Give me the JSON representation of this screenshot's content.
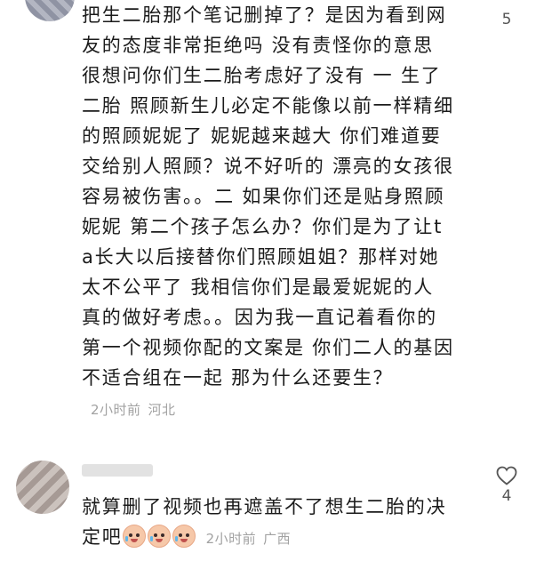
{
  "comments": [
    {
      "text": "把生二胎那个笔记删掉了？是因为看到网友的态度非常拒绝吗 没有责怪你的意思 很想问你们生二胎考虑好了没有 一 生了二胎 照顾新生儿必定不能像以前一样精细的照顾妮妮了 妮妮越来越大 你们难道要交给别人照顾？说不好听的 漂亮的女孩很容易被伤害。。二 如果你们还是贴身照顾妮妮 第二个孩子怎么办？你们是为了让ta长大以后接替你们照顾姐姐？那样对她太不公平了 我相信你们是最爱妮妮的人 真的做好考虑。。因为我一直记着看你的第一个视频你配的文案是 你们二人的基因不适合组在一起 那为什么还要生？",
      "time": "2小时前",
      "location": "河北",
      "likes": "5"
    },
    {
      "text": "就算删了视频也再遮盖不了想生二胎的决定吧",
      "emoji": [
        "crying-laughing-emoji",
        "crying-laughing-emoji",
        "crying-laughing-emoji"
      ],
      "time": "2小时前",
      "location": "广西",
      "likes": "4"
    }
  ]
}
